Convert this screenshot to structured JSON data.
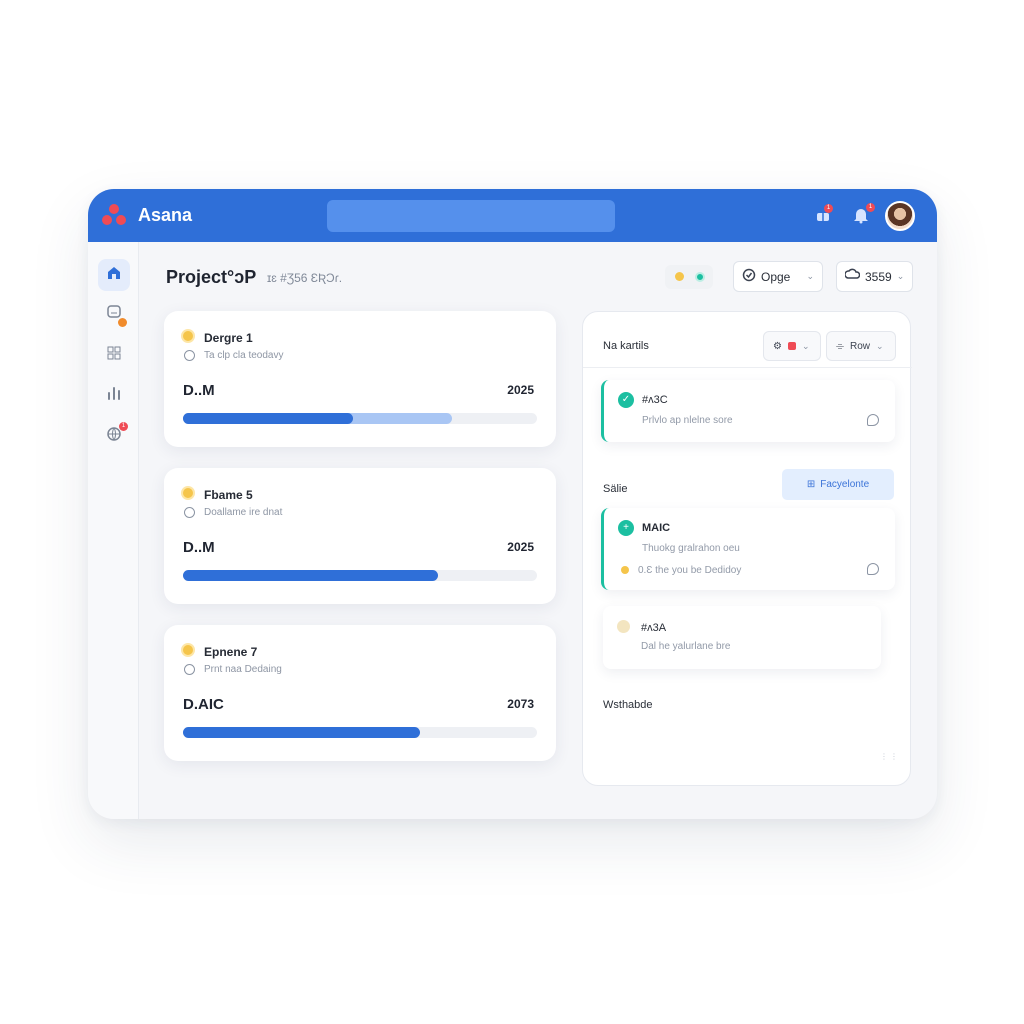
{
  "app": {
    "name": "Asana"
  },
  "header": {
    "search": {
      "value": "",
      "placeholder": ""
    },
    "notifications": [
      {
        "icon": "gift-icon",
        "badge": "1"
      },
      {
        "icon": "bell-icon",
        "badge": "1"
      }
    ],
    "avatar_icon": "user-avatar"
  },
  "sidebar": {
    "items": [
      {
        "icon": "home-icon",
        "active": true
      },
      {
        "icon": "message-icon",
        "badge": ""
      },
      {
        "icon": "grid-icon"
      },
      {
        "icon": "bar-chart-icon"
      },
      {
        "icon": "globe-icon",
        "badge": "1"
      }
    ]
  },
  "project": {
    "title": "Project°ɔP",
    "subtitle": "ɪɛ  #Ʒ56 ƐƦƆɾ.",
    "status": {
      "yellow": "#f5c54b",
      "teal": "#1cbfa1"
    },
    "filter_label": "Opge",
    "count_label": "3559"
  },
  "cards": [
    {
      "title": "Dergre 1",
      "subtitle": "Ta clp cla teodavy",
      "label": "D..M",
      "year": "2025",
      "progress": 0.76,
      "secondary_progress": 0.48
    },
    {
      "title": "Fbame 5",
      "subtitle": "Doallame ire dnat",
      "label": "D..M",
      "year": "2025",
      "progress": 0.72
    },
    {
      "title": "Epnene 7",
      "subtitle": "Prnt naa Dedaing",
      "label": "D.AIC",
      "year": "2073",
      "progress": 0.67
    }
  ],
  "panel": {
    "title": "Na kartils",
    "filter_button": "",
    "row_button": "Row",
    "items": [
      {
        "title": "#ʌ3C",
        "subtitle": "Prlvlo ap nlelne sore",
        "checked": true
      },
      {
        "title": "MAIC",
        "subtitle": "Thuokg gralrahon oeu",
        "meta": "0.Ɛ the you be Dedidoy",
        "checked": true
      },
      {
        "title": "#ʌ3A",
        "subtitle": "Dal he yalurlane bre"
      }
    ],
    "section_1": "Sälie",
    "facet_button": "Facyelonte",
    "section_2": "Wsthabde"
  }
}
